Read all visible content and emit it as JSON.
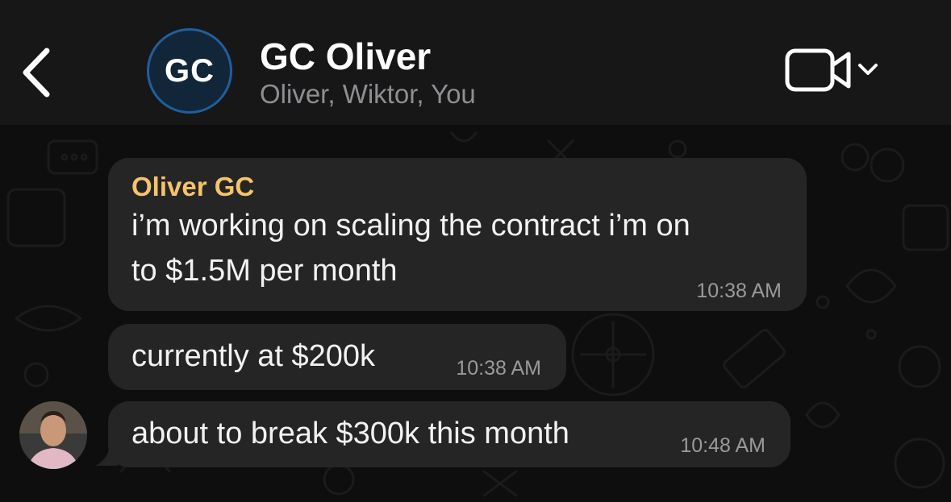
{
  "header": {
    "title": "GC Oliver",
    "subtitle": "Oliver, Wiktor, You",
    "avatar_initials": "GC",
    "back_icon": "chevron-left-icon",
    "video_icon": "video-camera-icon"
  },
  "colors": {
    "header_bg": "#171717",
    "bubble_bg": "#252525",
    "sender_name": "#f4c36b",
    "avatar_ring": "#1f5f9b"
  },
  "messages": [
    {
      "sender": "Oliver GC",
      "lines": [
        "i’m working on scaling the contract i’m on",
        "to $1.5M per month"
      ],
      "time": "10:38 AM"
    },
    {
      "text": "currently at $200k",
      "time": "10:38 AM"
    },
    {
      "text": "about to break $300k this month",
      "time": "10:48 AM"
    }
  ]
}
